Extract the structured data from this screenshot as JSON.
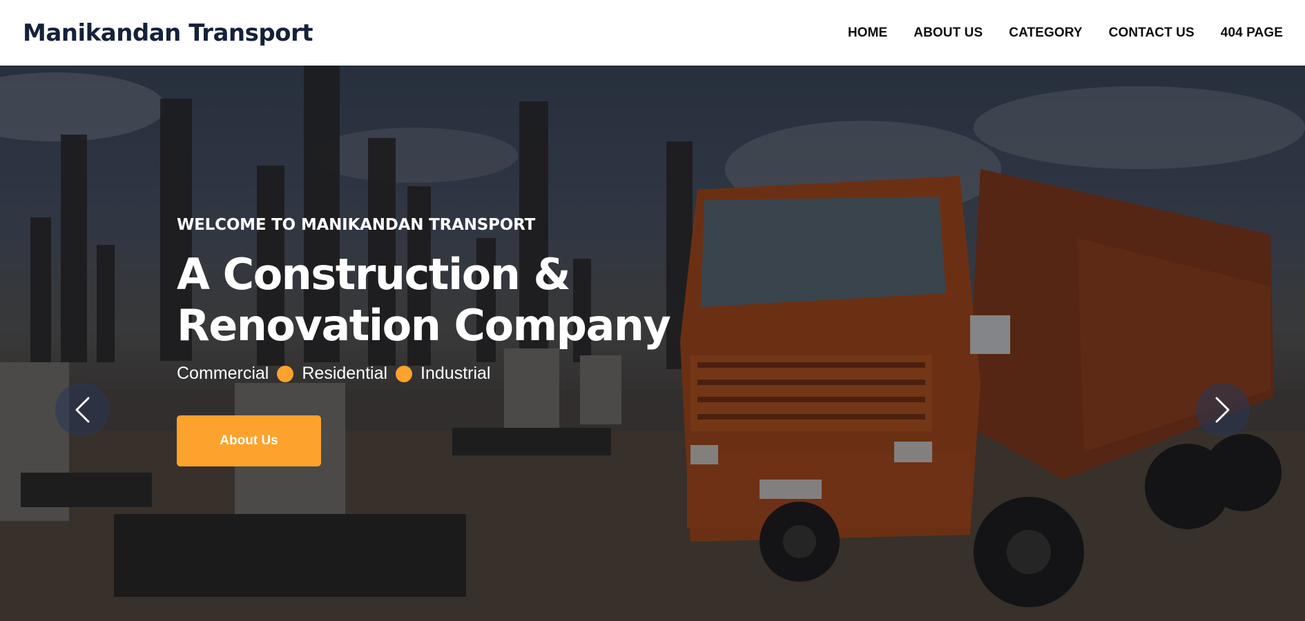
{
  "brand": {
    "name": "Manikandan Transport"
  },
  "nav": {
    "items": [
      {
        "label": "HOME"
      },
      {
        "label": "ABOUT US"
      },
      {
        "label": "CATEGORY"
      },
      {
        "label": "CONTACT US"
      },
      {
        "label": "404 PAGE"
      }
    ]
  },
  "hero": {
    "eyebrow": "WELCOME TO MANIKANDAN TRANSPORT",
    "headline_line1": "A Construction &",
    "headline_line2": "Renovation Company",
    "tags": [
      "Commercial",
      "Residential",
      "Industrial"
    ],
    "cta_label": "About Us",
    "accent_color": "#fda22c",
    "image": "construction site with orange dump truck"
  },
  "carousel": {
    "prev_icon": "chevron-left-icon",
    "next_icon": "chevron-right-icon"
  }
}
